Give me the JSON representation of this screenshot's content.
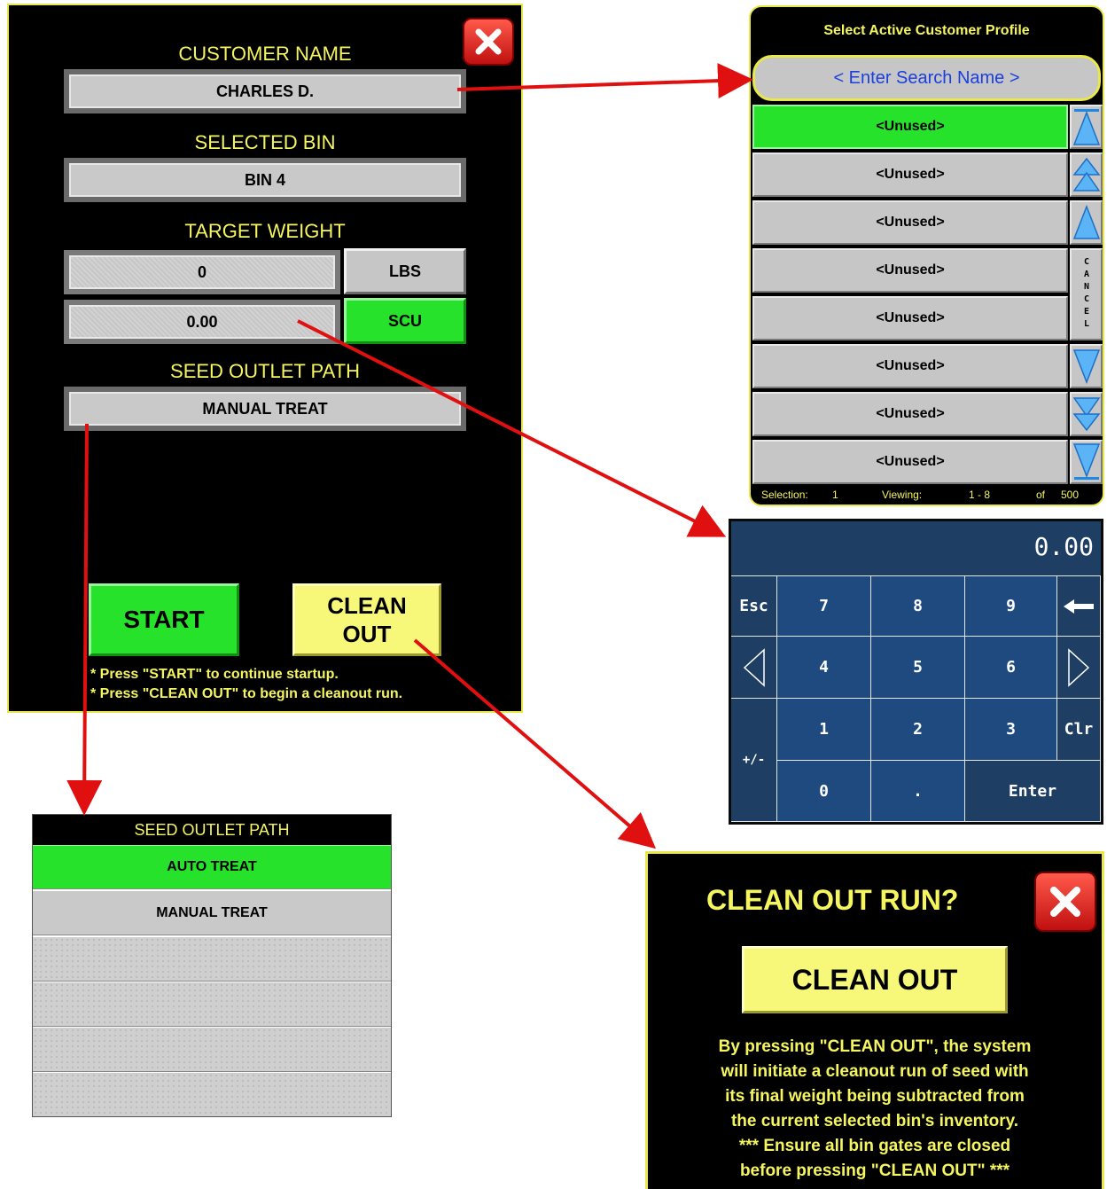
{
  "main": {
    "customer_label": "CUSTOMER NAME",
    "customer_value": "CHARLES D.",
    "bin_label": "SELECTED BIN",
    "bin_value": "BIN 4",
    "target_label": "TARGET WEIGHT",
    "weight_value": "0",
    "weight_unit": "LBS",
    "scu_value": "0.00",
    "scu_unit": "SCU",
    "outlet_label": "SEED OUTLET PATH",
    "outlet_value": "MANUAL TREAT",
    "start_label": "START",
    "clean_label_1": "CLEAN",
    "clean_label_2": "OUT",
    "hint_1": "* Press \"START\" to continue startup.",
    "hint_2": "* Press \"CLEAN OUT\" to begin a cleanout run.",
    "close_icon": "close-icon"
  },
  "profile": {
    "title": "Select Active Customer Profile",
    "search_placeholder": "< Enter Search Name >",
    "rows": [
      "<Unused>",
      "<Unused>",
      "<Unused>",
      "<Unused>",
      "<Unused>",
      "<Unused>",
      "<Unused>",
      "<Unused>"
    ],
    "cancel_label": "CANCEL",
    "status": {
      "selection_label": "Selection:",
      "selection_value": "1",
      "viewing_label": "Viewing:",
      "viewing_value": "1 - 8",
      "of_label": "of",
      "of_value": "500"
    }
  },
  "keypad": {
    "display": "0.00",
    "keys": {
      "esc": "Esc",
      "k7": "7",
      "k8": "8",
      "k9": "9",
      "k4": "4",
      "k5": "5",
      "k6": "6",
      "k1": "1",
      "k2": "2",
      "k3": "3",
      "clr": "Clr",
      "plusminus": "+/-",
      "k0": "0",
      "dot": ".",
      "enter": "Enter"
    }
  },
  "seed_outlet": {
    "title": "SEED OUTLET PATH",
    "options": [
      "AUTO TREAT",
      "MANUAL TREAT"
    ]
  },
  "clean_out": {
    "title": "CLEAN OUT RUN?",
    "button": "CLEAN OUT",
    "message": [
      "By pressing \"CLEAN OUT\", the system",
      "will initiate a cleanout run of seed with",
      "its final weight being subtracted from",
      "the current selected bin's inventory.",
      "*** Ensure all bin gates are closed",
      "before pressing \"CLEAN OUT\" ***"
    ]
  },
  "colors": {
    "yellow_text": "#f5f560",
    "green": "#27e22a",
    "gray": "#c6c6c6",
    "keypad_blue": "#1e4a80",
    "arrow_red": "#e01010"
  }
}
